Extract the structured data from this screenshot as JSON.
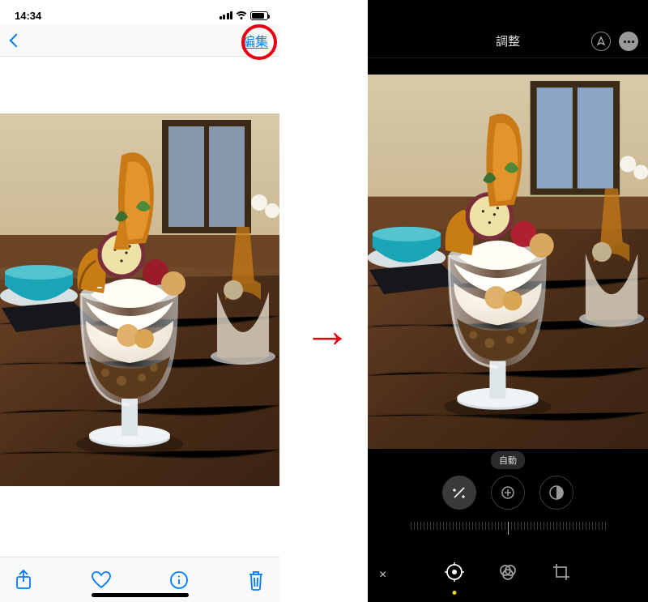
{
  "left": {
    "status": {
      "time": "14:34"
    },
    "nav": {
      "edit_label": "編集"
    },
    "toolbar": {
      "share": "share-icon",
      "favorite": "heart-icon",
      "info": "info-icon",
      "delete": "trash-icon"
    }
  },
  "arrow_glyph": "→",
  "right": {
    "header": {
      "title": "調整",
      "markup_icon": "markup-icon",
      "more_icon": "more-icon"
    },
    "auto_label": "自動",
    "adjust_tools": [
      {
        "name": "auto-enhance",
        "active": true
      },
      {
        "name": "exposure",
        "active": false
      },
      {
        "name": "brilliance",
        "active": false
      }
    ],
    "modes": {
      "cancel": "×",
      "adjust": "adjust-mode",
      "filters": "filters-mode",
      "crop": "crop-mode"
    }
  },
  "colors": {
    "ios_blue": "#007aff",
    "annotation_red": "#e60012",
    "edit_yellow": "#ffd60a"
  }
}
